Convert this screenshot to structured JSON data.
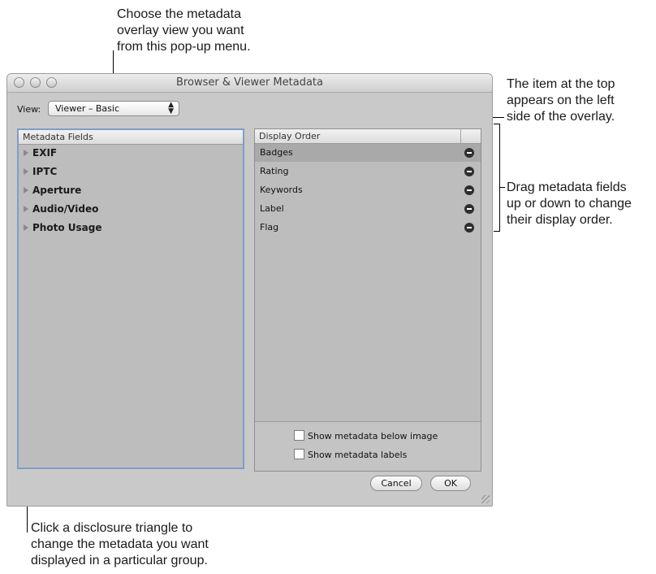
{
  "callouts": {
    "top": [
      "Choose the metadata",
      "overlay view you want",
      "from this pop-up menu."
    ],
    "right_top": [
      "The item at the top",
      "appears on the left",
      "side of the overlay."
    ],
    "right_mid": [
      "Drag metadata fields",
      "up or down to change",
      "their display order."
    ],
    "bottom": [
      "Click a disclosure triangle to",
      "change the metadata you want",
      "displayed in a particular group."
    ]
  },
  "window": {
    "title": "Browser & Viewer Metadata",
    "view_label": "View:",
    "view_popup_value": "Viewer – Basic"
  },
  "metadata_fields": {
    "header": "Metadata Fields",
    "groups": [
      "EXIF",
      "IPTC",
      "Aperture",
      "Audio/Video",
      "Photo Usage"
    ]
  },
  "display_order": {
    "header": "Display Order",
    "items": [
      "Badges",
      "Rating",
      "Keywords",
      "Label",
      "Flag"
    ],
    "selected_index": 0
  },
  "options": {
    "show_below": "Show metadata below image",
    "show_labels": "Show metadata labels"
  },
  "buttons": {
    "cancel": "Cancel",
    "ok": "OK"
  }
}
